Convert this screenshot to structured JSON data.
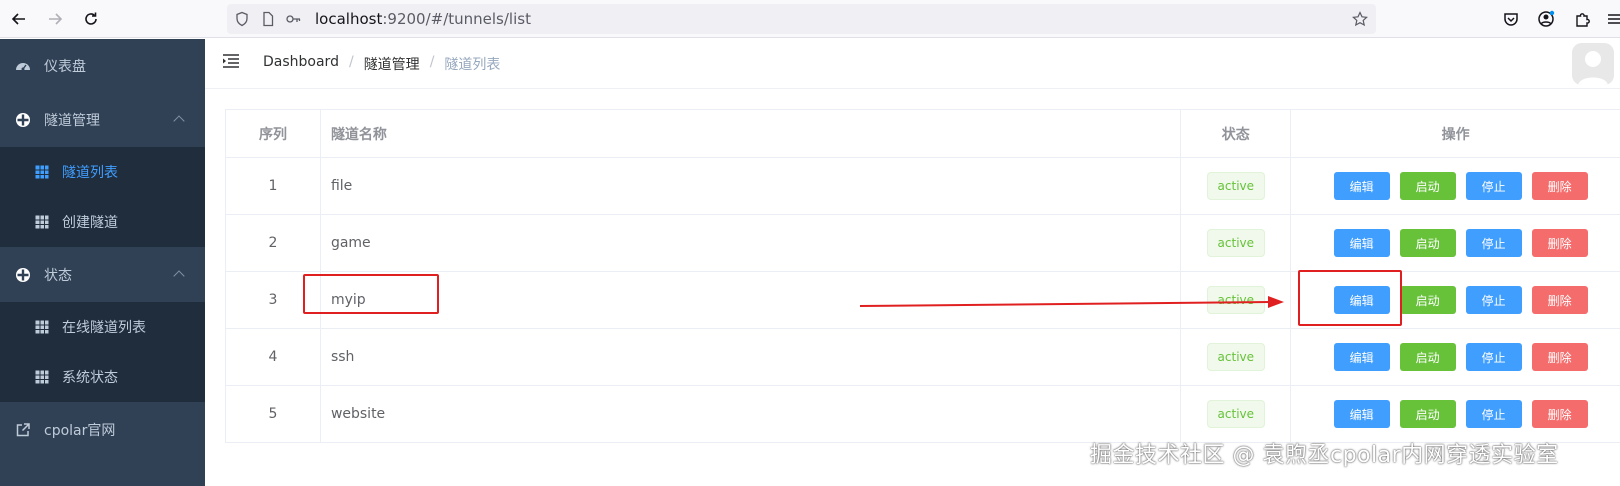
{
  "browser": {
    "url_host": "localhost",
    "url_rest": ":9200/#/tunnels/list"
  },
  "sidebar": {
    "items": [
      {
        "label": "仪表盘",
        "icon": "dashboard-icon",
        "type": "top"
      },
      {
        "label": "隧道管理",
        "icon": "tunnel-icon",
        "type": "group"
      },
      {
        "label": "隧道列表",
        "icon": "grid-icon",
        "type": "sub",
        "active": true
      },
      {
        "label": "创建隧道",
        "icon": "grid-icon",
        "type": "sub"
      },
      {
        "label": "状态",
        "icon": "status-icon",
        "type": "group"
      },
      {
        "label": "在线隧道列表",
        "icon": "grid-icon",
        "type": "sub"
      },
      {
        "label": "系统状态",
        "icon": "grid-icon",
        "type": "sub"
      },
      {
        "label": "cpolar官网",
        "icon": "external-link-icon",
        "type": "top"
      }
    ]
  },
  "breadcrumb": {
    "items": [
      "Dashboard",
      "隧道管理",
      "隧道列表"
    ]
  },
  "table": {
    "headers": [
      "序列",
      "隧道名称",
      "状态",
      "操作"
    ],
    "rows": [
      {
        "index": "1",
        "name": "file",
        "status": "active"
      },
      {
        "index": "2",
        "name": "game",
        "status": "active"
      },
      {
        "index": "3",
        "name": "myip",
        "status": "active"
      },
      {
        "index": "4",
        "name": "ssh",
        "status": "active"
      },
      {
        "index": "5",
        "name": "website",
        "status": "active"
      }
    ],
    "actions": {
      "edit": "编辑",
      "start": "启动",
      "stop": "停止",
      "delete": "删除"
    }
  },
  "colors": {
    "sidebar_bg": "#304156",
    "submenu_bg": "#1f2d3d",
    "active": "#409eff",
    "success": "#67c23a",
    "danger": "#f56c6c",
    "annotation": "#e02020"
  },
  "watermark": "掘金技术社区 @ 袁煦丞cpolar内网穿透实验室"
}
